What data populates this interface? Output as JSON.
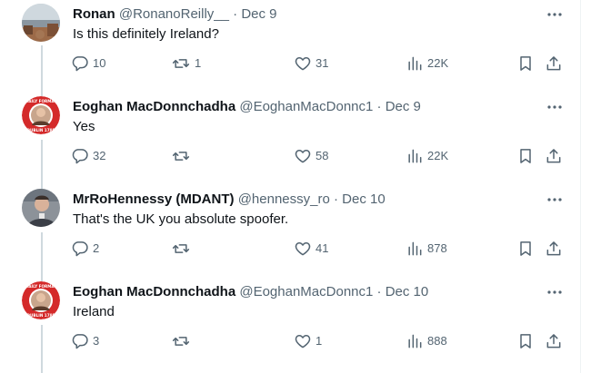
{
  "tweets": [
    {
      "name": "Ronan",
      "handle": "@RonanoReilly__",
      "separator": "·",
      "date": "Dec 9",
      "text": "Is this definitely Ireland?",
      "replies": "10",
      "retweets": "1",
      "likes": "31",
      "views": "22K",
      "avatar": "landscape-photo-avatar"
    },
    {
      "name": "Eoghan MacDonnchadha",
      "handle": "@EoghanMacDonnc1",
      "separator": "·",
      "date": "Dec 9",
      "text": "Yes",
      "replies": "32",
      "retweets": "",
      "likes": "58",
      "views": "22K",
      "avatar": "red-badge-avatar",
      "avatar_badge_text_top": "DAILY FORMAT",
      "avatar_badge_text_bottom": "DUBLIN 1785"
    },
    {
      "name": "MrRoHennessy (MDANT)",
      "handle": "@hennessy_ro",
      "separator": "·",
      "date": "Dec 10",
      "text": "That's the UK you absolute spoofer.",
      "replies": "2",
      "retweets": "",
      "likes": "41",
      "views": "878",
      "avatar": "person-photo-avatar"
    },
    {
      "name": "Eoghan MacDonnchadha",
      "handle": "@EoghanMacDonnc1",
      "separator": "·",
      "date": "Dec 10",
      "text": "Ireland",
      "replies": "3",
      "retweets": "",
      "likes": "1",
      "views": "888",
      "avatar": "red-badge-avatar",
      "avatar_badge_text_top": "DAILY FORMAT",
      "avatar_badge_text_bottom": "DUBLIN 1785"
    }
  ],
  "icons": {
    "reply": "reply-icon",
    "retweet": "retweet-icon",
    "like": "heart-icon",
    "views": "views-icon",
    "bookmark": "bookmark-icon",
    "share": "share-icon",
    "more": "more-icon"
  },
  "colors": {
    "text": "#0f1419",
    "secondary": "#536471",
    "thread_line": "#cfd9de",
    "badge_red": "#d42a2a"
  }
}
